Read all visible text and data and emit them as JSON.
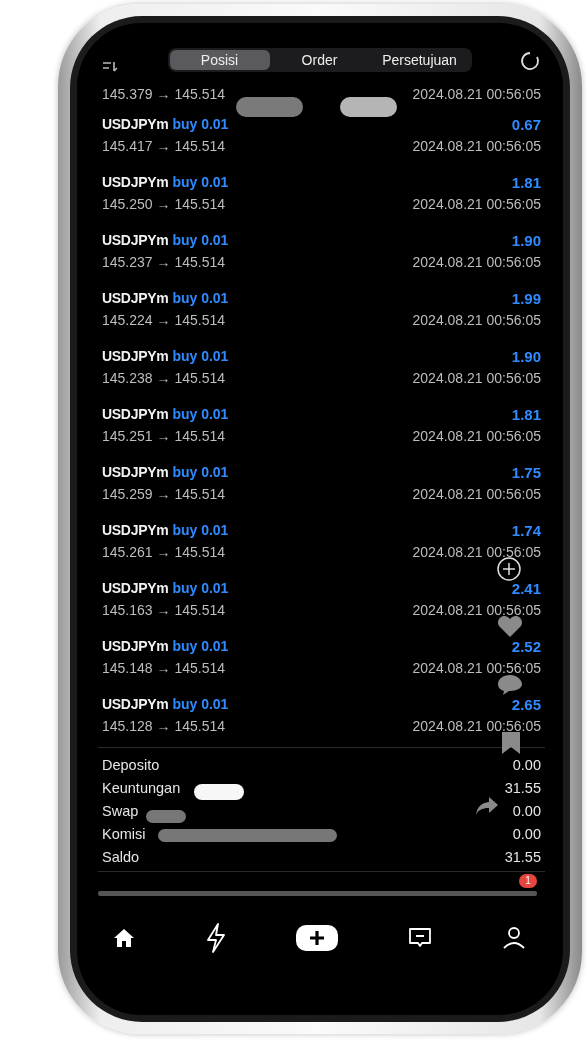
{
  "tabs": [
    {
      "label": "Posisi",
      "selected": true
    },
    {
      "label": "Order",
      "selected": false
    },
    {
      "label": "Persetujuan",
      "selected": false
    }
  ],
  "first_row": {
    "prices": "145.379 → 145.514",
    "time": "2024.08.21 00:56:05"
  },
  "trades": [
    {
      "symbol": "USDJPYm",
      "side": "buy 0.01",
      "profit": "0.67",
      "prices": "145.417 → 145.514",
      "time": "2024.08.21 00:56:05"
    },
    {
      "symbol": "USDJPYm",
      "side": "buy 0.01",
      "profit": "1.81",
      "prices": "145.250 → 145.514",
      "time": "2024.08.21 00:56:05"
    },
    {
      "symbol": "USDJPYm",
      "side": "buy 0.01",
      "profit": "1.90",
      "prices": "145.237 → 145.514",
      "time": "2024.08.21 00:56:05"
    },
    {
      "symbol": "USDJPYm",
      "side": "buy 0.01",
      "profit": "1.99",
      "prices": "145.224 → 145.514",
      "time": "2024.08.21 00:56:05"
    },
    {
      "symbol": "USDJPYm",
      "side": "buy 0.01",
      "profit": "1.90",
      "prices": "145.238 → 145.514",
      "time": "2024.08.21 00:56:05"
    },
    {
      "symbol": "USDJPYm",
      "side": "buy 0.01",
      "profit": "1.81",
      "prices": "145.251 → 145.514",
      "time": "2024.08.21 00:56:05"
    },
    {
      "symbol": "USDJPYm",
      "side": "buy 0.01",
      "profit": "1.75",
      "prices": "145.259 → 145.514",
      "time": "2024.08.21 00:56:05"
    },
    {
      "symbol": "USDJPYm",
      "side": "buy 0.01",
      "profit": "1.74",
      "prices": "145.261 → 145.514",
      "time": "2024.08.21 00:56:05"
    },
    {
      "symbol": "USDJPYm",
      "side": "buy 0.01",
      "profit": "2.41",
      "prices": "145.163 → 145.514",
      "time": "2024.08.21 00:56:05"
    },
    {
      "symbol": "USDJPYm",
      "side": "buy 0.01",
      "profit": "2.52",
      "prices": "145.148 → 145.514",
      "time": "2024.08.21 00:56:05"
    },
    {
      "symbol": "USDJPYm",
      "side": "buy 0.01",
      "profit": "2.65",
      "prices": "145.128 → 145.514",
      "time": "2024.08.21 00:56:05"
    }
  ],
  "summary": [
    {
      "label": "Deposito",
      "value": "0.00"
    },
    {
      "label": "Keuntungan",
      "value": "31.55"
    },
    {
      "label": "Swap",
      "value": "0.00"
    },
    {
      "label": "Komisi",
      "value": "0.00"
    },
    {
      "label": "Saldo",
      "value": "31.55"
    }
  ],
  "badge": "1"
}
